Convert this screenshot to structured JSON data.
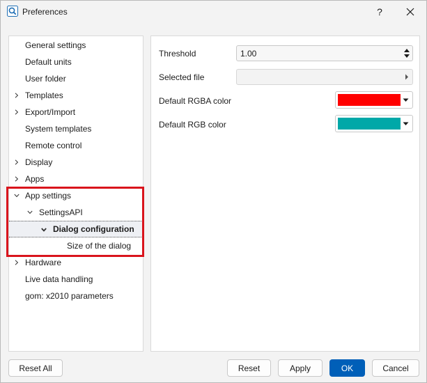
{
  "window": {
    "title": "Preferences",
    "help_label": "?",
    "close_label": "✕"
  },
  "tree": {
    "items": [
      {
        "label": "General settings",
        "level": 0,
        "expander": "none"
      },
      {
        "label": "Default units",
        "level": 0,
        "expander": "none"
      },
      {
        "label": "User folder",
        "level": 0,
        "expander": "none"
      },
      {
        "label": "Templates",
        "level": 0,
        "expander": "collapsed"
      },
      {
        "label": "Export/Import",
        "level": 0,
        "expander": "collapsed"
      },
      {
        "label": "System templates",
        "level": 0,
        "expander": "none"
      },
      {
        "label": "Remote control",
        "level": 0,
        "expander": "none"
      },
      {
        "label": "Display",
        "level": 0,
        "expander": "collapsed"
      },
      {
        "label": "Apps",
        "level": 0,
        "expander": "collapsed"
      },
      {
        "label": "App settings",
        "level": 0,
        "expander": "expanded"
      },
      {
        "label": "SettingsAPI",
        "level": 1,
        "expander": "expanded"
      },
      {
        "label": "Dialog configuration",
        "level": 2,
        "expander": "expanded",
        "selected": true
      },
      {
        "label": "Size of the dialog",
        "level": 3,
        "expander": "none"
      },
      {
        "label": "Hardware",
        "level": 0,
        "expander": "collapsed"
      },
      {
        "label": "Live data handling",
        "level": 0,
        "expander": "none"
      },
      {
        "label": "gom: x2010 parameters",
        "level": 0,
        "expander": "none"
      }
    ]
  },
  "settings": {
    "threshold_label": "Threshold",
    "threshold_value": "1.00",
    "selected_file_label": "Selected file",
    "selected_file_value": "",
    "rgba_label": "Default RGBA color",
    "rgba_color": "#ff0000",
    "rgb_label": "Default RGB color",
    "rgb_color": "#00a8a8"
  },
  "buttons": {
    "reset_all": "Reset All",
    "reset": "Reset",
    "apply": "Apply",
    "ok": "OK",
    "cancel": "Cancel"
  },
  "colors": {
    "accent": "#005fb8",
    "highlight_border": "#d9141c"
  }
}
